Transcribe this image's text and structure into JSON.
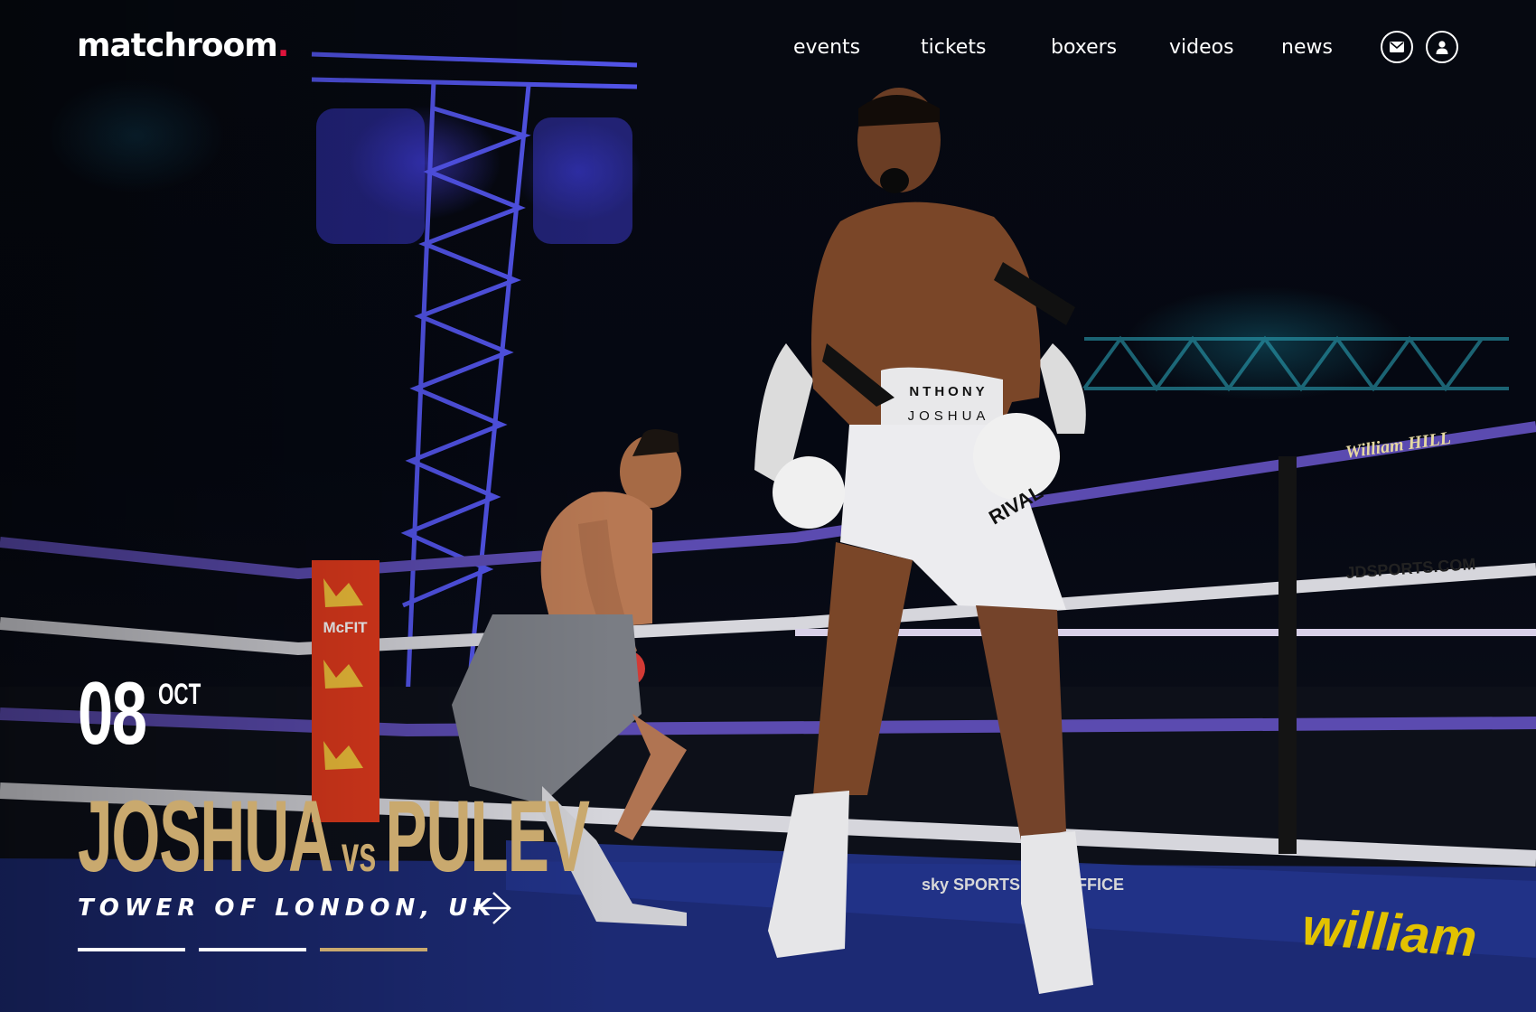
{
  "header": {
    "logo_text": "matchroom",
    "logo_dot": ".",
    "nav": [
      {
        "label": "events"
      },
      {
        "label": "tickets"
      },
      {
        "label": "boxers"
      },
      {
        "label": "videos"
      },
      {
        "label": "news"
      }
    ],
    "icons": {
      "mail": "mail-icon",
      "account": "user-icon"
    }
  },
  "hero": {
    "day": "08",
    "month": "OCT",
    "fighter_a": "JOSHUA",
    "vs": "vs",
    "fighter_b": "PULEV",
    "venue": "TOWER OF LONDON, UK",
    "slides": {
      "count": 3,
      "active_index": 2
    }
  },
  "photo_text": {
    "shorts_line1": "NTHONY",
    "shorts_line2": "JOSHUA",
    "glove": "RIVAL",
    "rope_sponsor_1": "William HILL",
    "rope_sponsor_2": "JDSPORTS.COM",
    "post_banner": "McFIT",
    "apron_1": "sky SPORTS BOX OFFICE",
    "apron_2": "william"
  },
  "colors": {
    "accent_gold": "#c9a96e",
    "logo_dot": "#e0143c",
    "text": "#ffffff"
  }
}
